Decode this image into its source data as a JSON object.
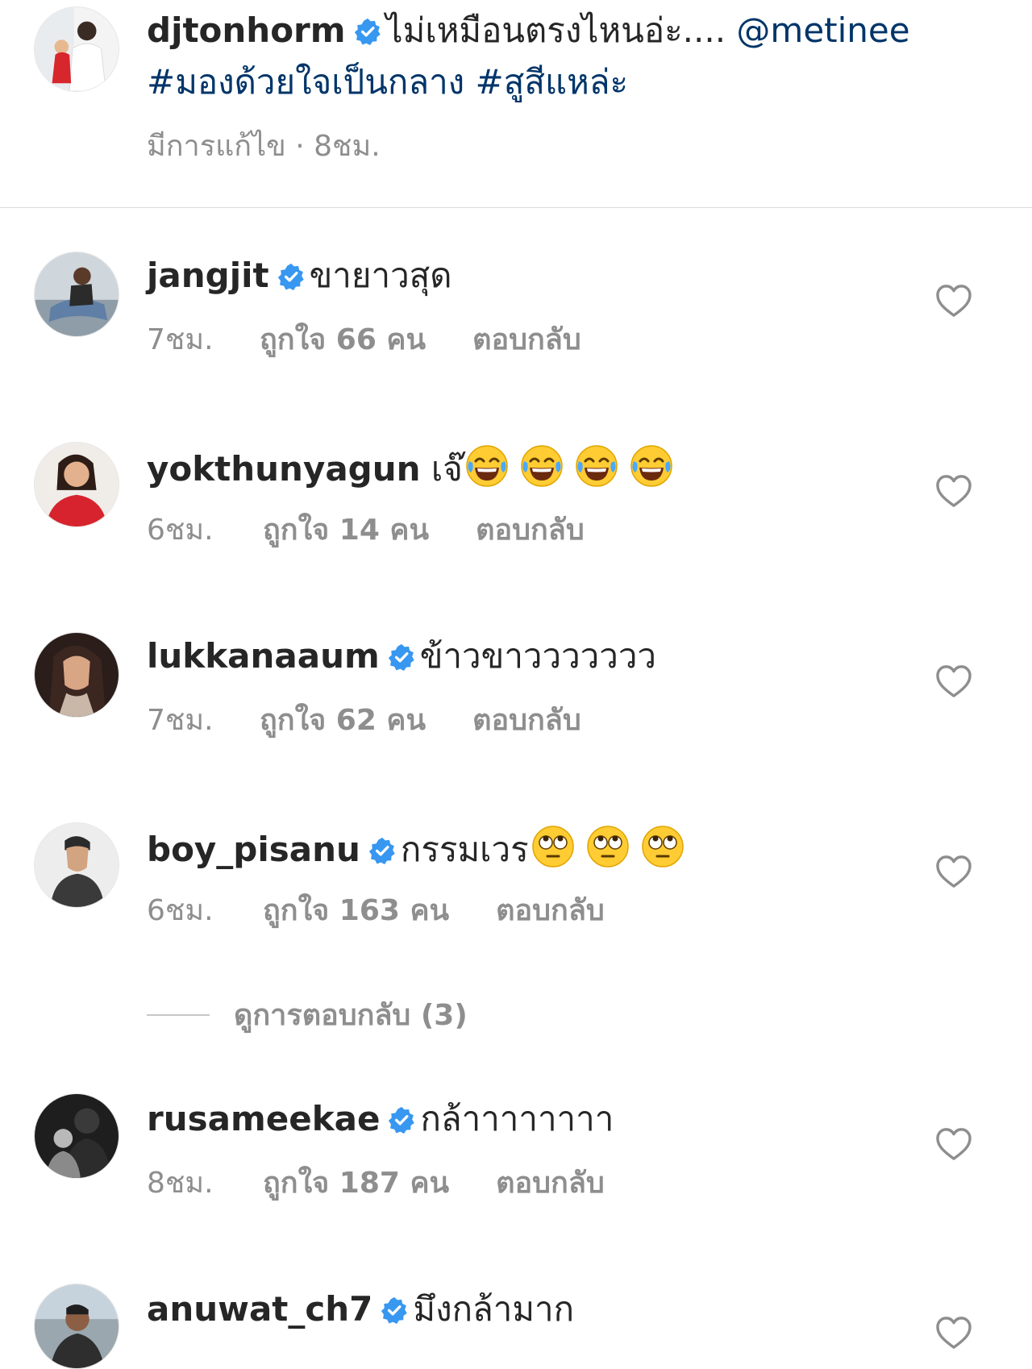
{
  "caption": {
    "username": "djtonhorm",
    "text": "ไม่เหมือนตรงไหนอ่ะ....",
    "mention": "@metinee",
    "hashtags": "#มองด้วยใจเป็นกลาง #สูสีแหล่ะ",
    "meta": "มีการแก้ไข · 8ชม."
  },
  "comments": [
    {
      "username": "jangjit",
      "verified": true,
      "text": "ขายาวสุด",
      "time": "7ชม.",
      "likes": "ถูกใจ 66 คน",
      "reply": "ตอบกลับ"
    },
    {
      "username": "yokthunyagun",
      "verified": false,
      "text": "เจ๊",
      "emoji": "face-with-tears-of-joy",
      "emoji_count": 4,
      "time": "6ชม.",
      "likes": "ถูกใจ 14 คน",
      "reply": "ตอบกลับ"
    },
    {
      "username": "lukkanaaum",
      "verified": true,
      "text": "ข้าวขาววววววว",
      "time": "7ชม.",
      "likes": "ถูกใจ 62 คน",
      "reply": "ตอบกลับ"
    },
    {
      "username": "boy_pisanu",
      "verified": true,
      "text": "กรรมเวร",
      "emoji": "face-with-rolling-eyes",
      "emoji_count": 3,
      "time": "6ชม.",
      "likes": "ถูกใจ 163 คน",
      "reply": "ตอบกลับ",
      "view_replies": "ดูการตอบกลับ (3)"
    },
    {
      "username": "rusameekae",
      "verified": true,
      "text": "กล้าาาาาาาา",
      "time": "8ชม.",
      "likes": "ถูกใจ 187 คน",
      "reply": "ตอบกลับ"
    },
    {
      "username": "anuwat_ch7",
      "verified": true,
      "text": "มึงกล้ามาก"
    }
  ],
  "colors": {
    "text": "#262626",
    "secondary": "#8e8e8e",
    "link": "#003569",
    "verified": "#3897f0",
    "divider": "#dbdbdb"
  }
}
